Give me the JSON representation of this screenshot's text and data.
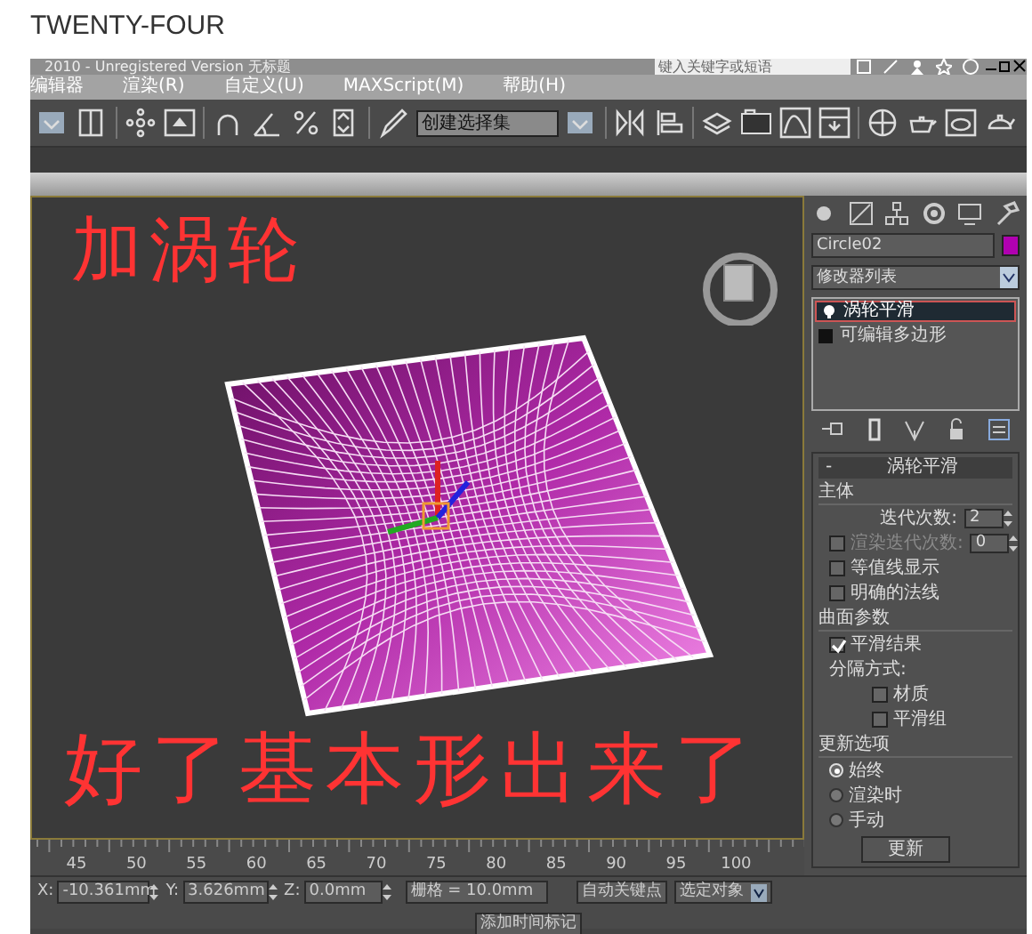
{
  "page_heading": "TWENTY-FOUR",
  "window": {
    "title": "2010  -  Unregistered Version   无标题",
    "search": {
      "placeholder": "键入关键字或短语"
    }
  },
  "menu": [
    {
      "label": "编辑器"
    },
    {
      "label": "渲染(R)"
    },
    {
      "label": "自定义(U)"
    },
    {
      "label": "MAXScript(M)"
    },
    {
      "label": "帮助(H)"
    }
  ],
  "toolbar": {
    "selection_set": "创建选择集"
  },
  "viewport": {
    "annotations": [
      {
        "kind": "top",
        "text": "加涡轮"
      },
      {
        "kind": "bottom",
        "text": "好了基本形出来了"
      }
    ]
  },
  "command_panel": {
    "object_name": "Circle02",
    "modifier_list": "修改器列表",
    "stack": [
      {
        "label": "涡轮平滑",
        "selected": true
      },
      {
        "label": "可编辑多边形",
        "selected": false
      }
    ],
    "rollout": {
      "collapse": "-",
      "title": "涡轮平滑",
      "groups": [
        {
          "title": "主体",
          "items": [
            {
              "kind": "spinner",
              "label": "迭代次数:",
              "value": "2",
              "disabled": false
            },
            {
              "kind": "check_spinner",
              "label": "渲染迭代次数:",
              "value": "0",
              "checked": false,
              "disabled": true
            },
            {
              "kind": "check",
              "label": "等值线显示",
              "checked": false
            },
            {
              "kind": "check",
              "label": "明确的法线",
              "checked": false
            }
          ]
        },
        {
          "title": "曲面参数",
          "items": [
            {
              "kind": "check",
              "label": "平滑结果",
              "checked": true
            },
            {
              "kind": "label",
              "label": "分隔方式:",
              "children": [
                {
                  "kind": "check",
                  "label": "材质",
                  "checked": false
                },
                {
                  "kind": "check",
                  "label": "平滑组",
                  "checked": false
                }
              ]
            }
          ]
        },
        {
          "title": "更新选项",
          "items": [
            {
              "kind": "radio",
              "label": "始终",
              "selected": true
            },
            {
              "kind": "radio",
              "label": "渲染时",
              "selected": false
            },
            {
              "kind": "radio",
              "label": "手动",
              "selected": false
            },
            {
              "kind": "button",
              "label": "更新"
            }
          ]
        }
      ]
    }
  },
  "ruler": {
    "ticks": [
      "45",
      "50",
      "55",
      "60",
      "65",
      "70",
      "75",
      "80",
      "85",
      "90",
      "95",
      "100"
    ]
  },
  "status_bar": {
    "x_label": "X:",
    "x": "-10.361mm",
    "y_label": "Y:",
    "y": "3.626mm",
    "z_label": "Z:",
    "z": "0.0mm",
    "grid": "栅格 = 10.0mm",
    "auto_key": "自动关键点",
    "key_filter": "选定对象",
    "time_tag": "添加时间标记"
  }
}
